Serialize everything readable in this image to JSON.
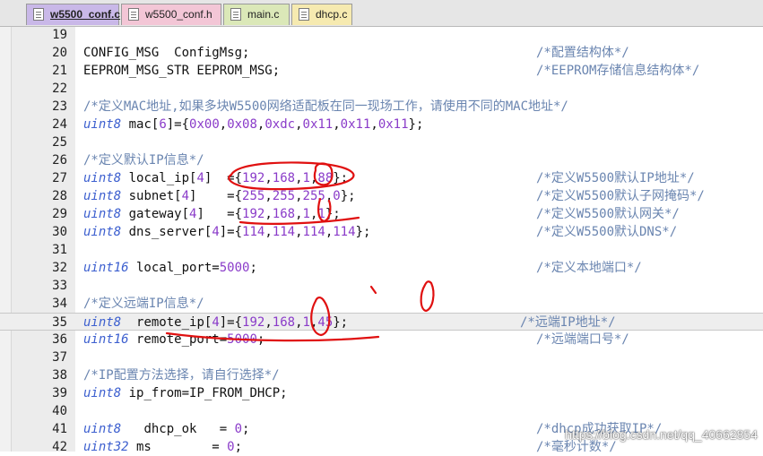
{
  "tabs": [
    {
      "label": "w5500_conf.c",
      "active": true,
      "color": "#c9b8e8"
    },
    {
      "label": "w5500_conf.h",
      "active": false,
      "color": "#f3c6d6"
    },
    {
      "label": "main.c",
      "active": false,
      "color": "#dbe8b8"
    },
    {
      "label": "dhcp.c",
      "active": false,
      "color": "#f6eab0"
    }
  ],
  "lines": [
    {
      "num": "19",
      "tokens": [],
      "comment": ""
    },
    {
      "num": "20",
      "tokens": [
        [
          "id",
          "CONFIG_MSG  ConfigMsg;"
        ]
      ],
      "comment": "/*配置结构体*/"
    },
    {
      "num": "21",
      "tokens": [
        [
          "id",
          "EEPROM_MSG_STR EEPROM_MSG;"
        ]
      ],
      "comment": "/*EEPROM存储信息结构体*/"
    },
    {
      "num": "22",
      "tokens": [],
      "comment": ""
    },
    {
      "num": "23",
      "tokens": [
        [
          "c",
          "/*定义MAC地址,如果多块W5500网络适配板在同一现场工作，请使用不同的MAC地址*/"
        ]
      ],
      "comment": ""
    },
    {
      "num": "24",
      "tokens": [
        [
          "kw",
          "uint8"
        ],
        [
          "id",
          " mac["
        ],
        [
          "num",
          "6"
        ],
        [
          "id",
          "]={"
        ],
        [
          "num",
          "0x00"
        ],
        [
          "id",
          ","
        ],
        [
          "num",
          "0x08"
        ],
        [
          "id",
          ","
        ],
        [
          "num",
          "0xdc"
        ],
        [
          "id",
          ","
        ],
        [
          "num",
          "0x11"
        ],
        [
          "id",
          ","
        ],
        [
          "num",
          "0x11"
        ],
        [
          "id",
          ","
        ],
        [
          "num",
          "0x11"
        ],
        [
          "id",
          "};"
        ]
      ],
      "comment": ""
    },
    {
      "num": "25",
      "tokens": [],
      "comment": ""
    },
    {
      "num": "26",
      "tokens": [
        [
          "c",
          "/*定义默认IP信息*/"
        ]
      ],
      "comment": ""
    },
    {
      "num": "27",
      "tokens": [
        [
          "kw",
          "uint8"
        ],
        [
          "id",
          " local_ip["
        ],
        [
          "num",
          "4"
        ],
        [
          "id",
          "]  ={"
        ],
        [
          "num",
          "192"
        ],
        [
          "id",
          ","
        ],
        [
          "num",
          "168"
        ],
        [
          "id",
          ","
        ],
        [
          "num",
          "1"
        ],
        [
          "id",
          ","
        ],
        [
          "num",
          "88"
        ],
        [
          "id",
          "};"
        ]
      ],
      "comment": "/*定义W5500默认IP地址*/"
    },
    {
      "num": "28",
      "tokens": [
        [
          "kw",
          "uint8"
        ],
        [
          "id",
          " subnet["
        ],
        [
          "num",
          "4"
        ],
        [
          "id",
          "]    ={"
        ],
        [
          "num",
          "255"
        ],
        [
          "id",
          ","
        ],
        [
          "num",
          "255"
        ],
        [
          "id",
          ","
        ],
        [
          "num",
          "255"
        ],
        [
          "id",
          ","
        ],
        [
          "num",
          "0"
        ],
        [
          "id",
          "};"
        ]
      ],
      "comment": "/*定义W5500默认子网掩码*/"
    },
    {
      "num": "29",
      "tokens": [
        [
          "kw",
          "uint8"
        ],
        [
          "id",
          " gateway["
        ],
        [
          "num",
          "4"
        ],
        [
          "id",
          "]   ={"
        ],
        [
          "num",
          "192"
        ],
        [
          "id",
          ","
        ],
        [
          "num",
          "168"
        ],
        [
          "id",
          ","
        ],
        [
          "num",
          "1"
        ],
        [
          "id",
          ","
        ],
        [
          "num",
          "1"
        ],
        [
          "id",
          "};"
        ]
      ],
      "comment": "/*定义W5500默认网关*/"
    },
    {
      "num": "30",
      "tokens": [
        [
          "kw",
          "uint8"
        ],
        [
          "id",
          " dns_server["
        ],
        [
          "num",
          "4"
        ],
        [
          "id",
          "]={"
        ],
        [
          "num",
          "114"
        ],
        [
          "id",
          ","
        ],
        [
          "num",
          "114"
        ],
        [
          "id",
          ","
        ],
        [
          "num",
          "114"
        ],
        [
          "id",
          ","
        ],
        [
          "num",
          "114"
        ],
        [
          "id",
          "};"
        ]
      ],
      "comment": "/*定义W5500默认DNS*/"
    },
    {
      "num": "31",
      "tokens": [],
      "comment": ""
    },
    {
      "num": "32",
      "tokens": [
        [
          "kw",
          "uint16"
        ],
        [
          "id",
          " local_port="
        ],
        [
          "num",
          "5000"
        ],
        [
          "id",
          ";"
        ]
      ],
      "comment": "/*定义本地端口*/"
    },
    {
      "num": "33",
      "tokens": [],
      "comment": ""
    },
    {
      "num": "34",
      "tokens": [
        [
          "c",
          "/*定义远端IP信息*/"
        ]
      ],
      "comment": ""
    },
    {
      "num": "35",
      "tokens": [
        [
          "kw",
          "uint8"
        ],
        [
          "id",
          "  remote_ip["
        ],
        [
          "num",
          "4"
        ],
        [
          "id",
          "]={"
        ],
        [
          "num",
          "192"
        ],
        [
          "id",
          ","
        ],
        [
          "num",
          "168"
        ],
        [
          "id",
          ","
        ],
        [
          "num",
          "1"
        ],
        [
          "id",
          ","
        ],
        [
          "num",
          "45"
        ],
        [
          "id",
          "};"
        ]
      ],
      "comment": "/*远端IP地址*/",
      "current": true
    },
    {
      "num": "36",
      "tokens": [
        [
          "kw",
          "uint16"
        ],
        [
          "id",
          " remote_port="
        ],
        [
          "num",
          "5000"
        ],
        [
          "id",
          ";"
        ]
      ],
      "comment": "/*远端端口号*/"
    },
    {
      "num": "37",
      "tokens": [],
      "comment": ""
    },
    {
      "num": "38",
      "tokens": [
        [
          "c",
          "/*IP配置方法选择，请自行选择*/"
        ]
      ],
      "comment": ""
    },
    {
      "num": "39",
      "tokens": [
        [
          "kw",
          "uint8"
        ],
        [
          "id",
          " ip_from=IP_FROM_DHCP;"
        ]
      ],
      "comment": ""
    },
    {
      "num": "40",
      "tokens": [],
      "comment": ""
    },
    {
      "num": "41",
      "tokens": [
        [
          "kw",
          "uint8"
        ],
        [
          "id",
          "   dhcp_ok   = "
        ],
        [
          "num",
          "0"
        ],
        [
          "id",
          ";"
        ]
      ],
      "comment": "/*dhcp成功获取IP*/"
    },
    {
      "num": "42",
      "tokens": [
        [
          "kw",
          "uint32"
        ],
        [
          "id",
          " ms        = "
        ],
        [
          "num",
          "0"
        ],
        [
          "id",
          ";"
        ]
      ],
      "comment": "/*毫秒计数*/"
    }
  ],
  "colors": {
    "keyword": "#3c5fcf",
    "number": "#8a3bc9",
    "comment": "#6a85b0",
    "annotation": "#e01010"
  },
  "watermark": "https://blog.csdn.net/qq_40662854"
}
